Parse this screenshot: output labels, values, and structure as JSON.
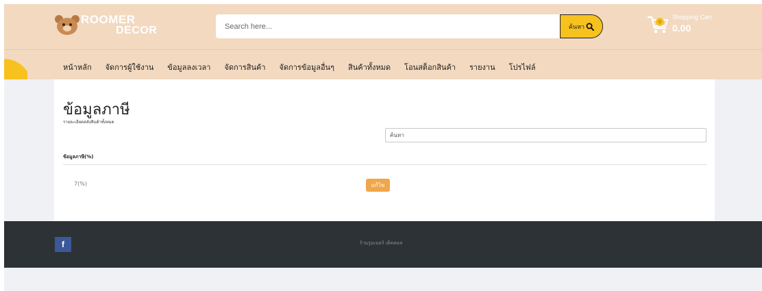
{
  "brand": {
    "line1": "ROOMER",
    "line2": "DECOR"
  },
  "search": {
    "placeholder": "Search here...",
    "button_label": "ค้นหา"
  },
  "cart": {
    "label": "Shopping Cart",
    "total": "0.00",
    "count": "0"
  },
  "nav": {
    "items": [
      "หน้าหลัก",
      "จัดการผู้ใช้งาน",
      "ข้อมูลลงเวลา",
      "จัดการสินค้า",
      "จัดการข้อมูลอื่นๆ",
      "สินค้าทั้งหมด",
      "โอนสต็อกสินค้า",
      "รายงาน",
      "โปรไฟล์"
    ]
  },
  "main": {
    "title": "ข้อมูลภาษี",
    "subtitle": "รายละเอียดคลังสินค้าทั้งหมด",
    "filter_placeholder": "ค้นหา",
    "table": {
      "header": "ข้อมูลภาษี(%)",
      "rows": [
        {
          "value": "7(%)",
          "action": "แก้ไข"
        }
      ]
    }
  },
  "footer": {
    "facebook": "f",
    "text": "ร้านรูมเมอร์ เด็คคอล"
  },
  "colors": {
    "header_bg": "#f2d9c0",
    "accent": "#f7c21e",
    "edit_button": "#f0a64a",
    "footer_bg": "#2d3236",
    "facebook": "#3b5998"
  },
  "icons": {
    "logo": "bear-logo-icon",
    "search": "magnifier-icon",
    "cart": "shopping-cart-icon",
    "facebook": "facebook-icon"
  }
}
